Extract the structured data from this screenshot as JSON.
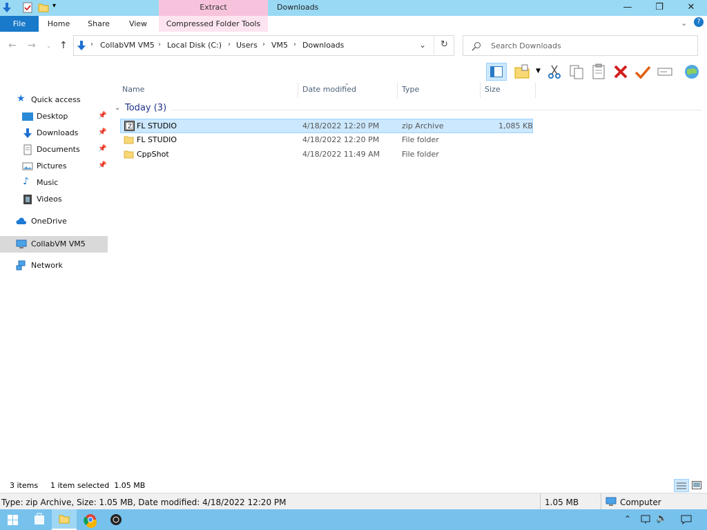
{
  "titlebar": {
    "context_tab": "Extract",
    "title": "Downloads",
    "minimize": "—",
    "maximize": "❐",
    "close": "✕"
  },
  "ribbon": {
    "tabs": [
      "File",
      "Home",
      "Share",
      "View",
      "Compressed Folder Tools"
    ]
  },
  "address": {
    "crumbs": [
      "CollabVM VM5",
      "Local Disk (C:)",
      "Users",
      "VM5",
      "Downloads"
    ]
  },
  "search": {
    "placeholder": "Search Downloads"
  },
  "nav": {
    "quick_access": "Quick access",
    "items": [
      {
        "label": "Desktop",
        "pinned": true
      },
      {
        "label": "Downloads",
        "pinned": true
      },
      {
        "label": "Documents",
        "pinned": true
      },
      {
        "label": "Pictures",
        "pinned": true
      },
      {
        "label": "Music",
        "pinned": false
      },
      {
        "label": "Videos",
        "pinned": false
      }
    ],
    "onedrive": "OneDrive",
    "this_pc": "CollabVM VM5",
    "network": "Network"
  },
  "columns": [
    "Name",
    "Date modified",
    "Type",
    "Size"
  ],
  "group": {
    "label": "Today (3)"
  },
  "files": [
    {
      "name": "FL STUDIO",
      "date": "4/18/2022 12:20 PM",
      "type": "zip Archive",
      "size": "1,085 KB",
      "selected": true,
      "kind": "zip"
    },
    {
      "name": "FL STUDIO",
      "date": "4/18/2022 12:20 PM",
      "type": "File folder",
      "size": "",
      "selected": false,
      "kind": "folder"
    },
    {
      "name": "CppShot",
      "date": "4/18/2022 11:49 AM",
      "type": "File folder",
      "size": "",
      "selected": false,
      "kind": "folder"
    }
  ],
  "status": {
    "count": "3 items",
    "selected": "1 item selected  1.05 MB"
  },
  "details": {
    "info": "Type: zip Archive, Size: 1.05 MB, Date modified: 4/18/2022 12:20 PM",
    "size": "1.05 MB",
    "location": "Computer"
  },
  "colors": {
    "titlebar": "#99d9f3",
    "accent": "#1979ca",
    "selection": "#cce8ff",
    "taskbar": "#76c2ed"
  }
}
